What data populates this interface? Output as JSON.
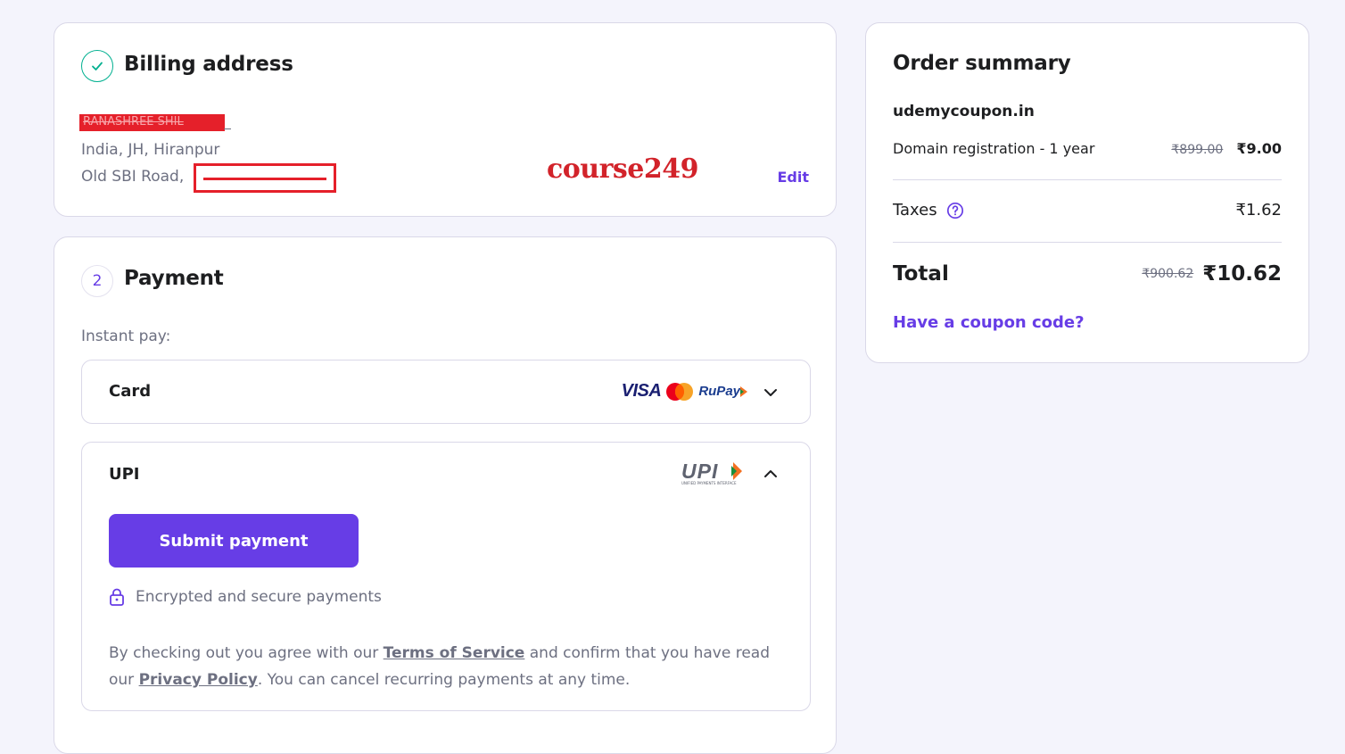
{
  "billing": {
    "title": "Billing address",
    "name_redacted": "RANASHREE SHIL",
    "line1": "India, JH, Hiranpur",
    "line2_prefix": "Old SBI Road,",
    "watermark": "course249",
    "edit_label": "Edit"
  },
  "payment": {
    "step_number": "2",
    "title": "Payment",
    "instant_label": "Instant pay:",
    "card_label": "Card",
    "card_brands": [
      "VISA",
      "RuPay"
    ],
    "upi_label": "UPI",
    "upi_logo_text": "UPI",
    "upi_logo_sub": "UNIFIED PAYMENTS INTERFACE",
    "submit_label": "Submit payment",
    "secure_label": "Encrypted and secure payments",
    "terms_text_1": "By checking out you agree with our ",
    "terms_link": "Terms of Service",
    "terms_text_2": " and confirm that you have read our ",
    "privacy_link": "Privacy Policy",
    "terms_text_3": ". You can cancel recurring payments at any time."
  },
  "summary": {
    "title": "Order summary",
    "domain": "udemycoupon.in",
    "item_label": "Domain registration - 1 year",
    "item_old_price": "₹899.00",
    "item_price": "₹9.00",
    "taxes_label": "Taxes",
    "taxes_value": "₹1.62",
    "total_label": "Total",
    "total_old": "₹900.62",
    "total_value": "₹10.62",
    "coupon_label": "Have a coupon code?"
  },
  "colors": {
    "accent": "#673de6",
    "success": "#00b090",
    "redaction": "#e5202a",
    "text_dark": "#1d1e20",
    "text_muted": "#6d7081",
    "page_bg": "#f4f4fc"
  },
  "icons": [
    "check-icon",
    "question-icon",
    "lock-icon",
    "chevron-down-icon",
    "chevron-up-icon",
    "visa-logo",
    "mastercard-logo",
    "rupay-logo",
    "upi-logo"
  ]
}
